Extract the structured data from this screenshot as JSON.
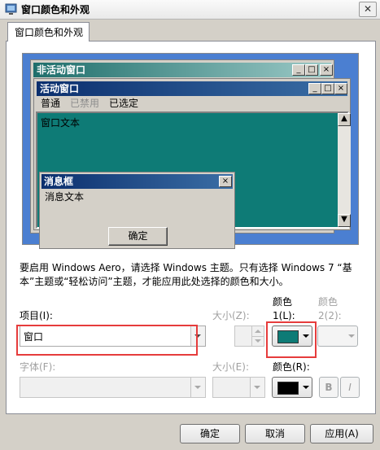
{
  "window": {
    "title": "窗口颜色和外观",
    "close_glyph": "✕"
  },
  "tab": {
    "label": "窗口颜色和外观"
  },
  "preview": {
    "inactive_title": "非活动窗口",
    "active_title": "活动窗口",
    "menu": {
      "normal": "普通",
      "disabled": "已禁用",
      "selected": "已选定"
    },
    "window_text": "窗口文本",
    "message_box": {
      "title": "消息框",
      "text": "消息文本",
      "ok_label": "确定"
    },
    "caption_buttons": {
      "minimize": "_",
      "maximize": "□",
      "close": "×"
    },
    "scroll": {
      "up": "▲",
      "down": "▼"
    }
  },
  "info": {
    "line1": "要启用 Windows Aero，请选择 Windows 主题。只有选择 Windows 7 “基",
    "line2": "本”主题或“轻松访问”主题，才能应用此处选择的颜色和大小。"
  },
  "item": {
    "label": "项目(I):",
    "value": "窗口"
  },
  "item_size": {
    "label": "大小(Z):"
  },
  "color1": {
    "label_line1": "颜色",
    "label_line2": "1(L):",
    "value": "#0e7b76"
  },
  "color2": {
    "label_line1": "颜色",
    "label_line2": "2(2):"
  },
  "font": {
    "label": "字体(F):"
  },
  "font_size": {
    "label": "大小(E):"
  },
  "font_color": {
    "label": "颜色(R):",
    "value": "#000000"
  },
  "font_style": {
    "bold": "B",
    "italic": "I"
  },
  "buttons": {
    "ok": "确定",
    "cancel": "取消",
    "apply": "应用(A)"
  },
  "colors": {
    "active_title_start": "#0b2f6e",
    "inactive_title_start": "#1e6e6b",
    "desktop": "#4b7fd1",
    "highlight_border": "#e63c3c"
  }
}
